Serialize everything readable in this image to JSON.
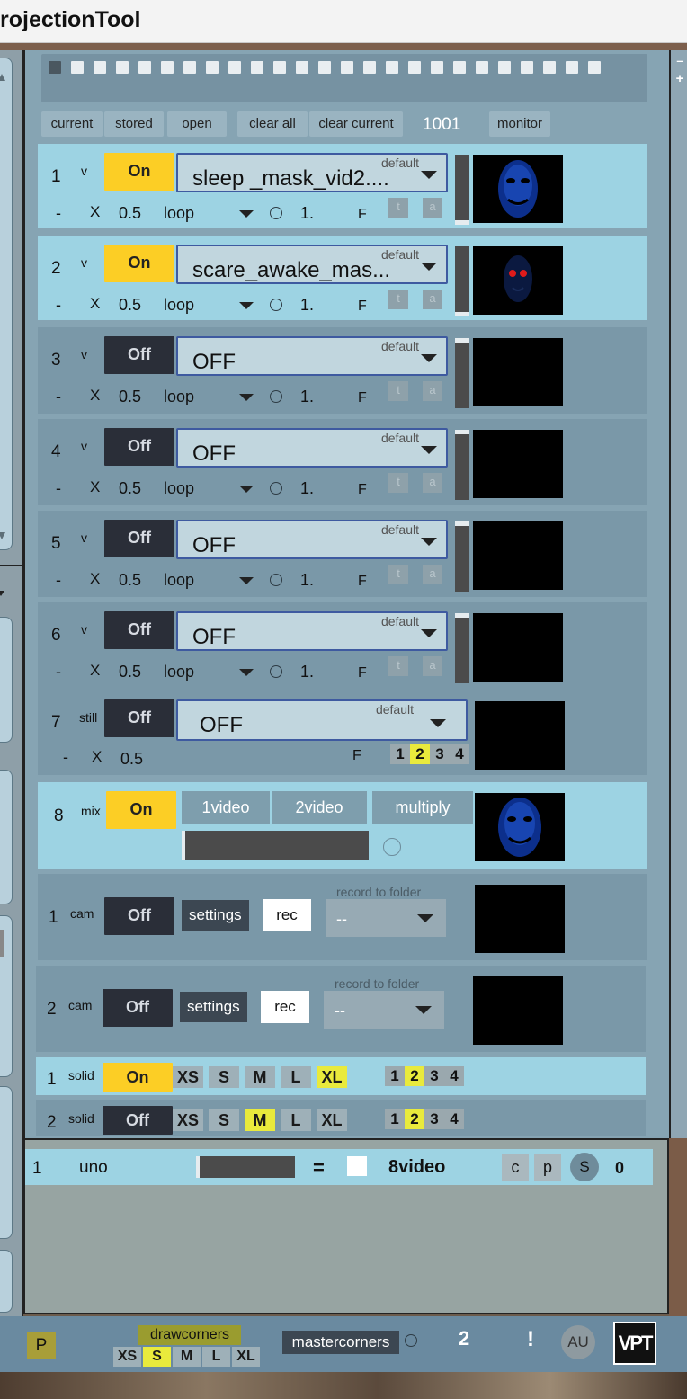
{
  "window": {
    "title": "rojectionTool"
  },
  "presets": {
    "count": 25,
    "selected_index": 0
  },
  "toolbar": {
    "current": "current",
    "stored": "stored",
    "open": "open",
    "clear_all": "clear all",
    "clear_current": "clear current",
    "counter": "1001",
    "monitor": "monitor"
  },
  "video_rows": [
    {
      "num": "1",
      "type": "v",
      "state": "On",
      "default_label": "default",
      "file": "sleep _mask_vid2....",
      "minus": "-",
      "x": "X",
      "speed": "0.5",
      "loop": "loop",
      "rate": "1.",
      "f": "F",
      "t": "t",
      "a": "a",
      "thumb": "face-blue"
    },
    {
      "num": "2",
      "type": "v",
      "state": "On",
      "default_label": "default",
      "file": "scare_awake_mas...",
      "minus": "-",
      "x": "X",
      "speed": "0.5",
      "loop": "loop",
      "rate": "1.",
      "f": "F",
      "t": "t",
      "a": "a",
      "thumb": "face-red-eyes"
    },
    {
      "num": "3",
      "type": "v",
      "state": "Off",
      "default_label": "default",
      "file": "OFF",
      "minus": "-",
      "x": "X",
      "speed": "0.5",
      "loop": "loop",
      "rate": "1.",
      "f": "F",
      "t": "t",
      "a": "a",
      "thumb": "black"
    },
    {
      "num": "4",
      "type": "v",
      "state": "Off",
      "default_label": "default",
      "file": "OFF",
      "minus": "-",
      "x": "X",
      "speed": "0.5",
      "loop": "loop",
      "rate": "1.",
      "f": "F",
      "t": "t",
      "a": "a",
      "thumb": "black"
    },
    {
      "num": "5",
      "type": "v",
      "state": "Off",
      "default_label": "default",
      "file": "OFF",
      "minus": "-",
      "x": "X",
      "speed": "0.5",
      "loop": "loop",
      "rate": "1.",
      "f": "F",
      "t": "t",
      "a": "a",
      "thumb": "black"
    },
    {
      "num": "6",
      "type": "v",
      "state": "Off",
      "default_label": "default",
      "file": "OFF",
      "minus": "-",
      "x": "X",
      "speed": "0.5",
      "loop": "loop",
      "rate": "1.",
      "f": "F",
      "t": "t",
      "a": "a",
      "thumb": "black"
    }
  ],
  "still_row": {
    "num": "7",
    "type": "still",
    "state": "Off",
    "default_label": "default",
    "file": "OFF",
    "minus": "-",
    "x": "X",
    "speed": "0.5",
    "f": "F",
    "nums": [
      "1",
      "2",
      "3",
      "4"
    ],
    "selected_num": "2"
  },
  "mix_row": {
    "num": "8",
    "type": "mix",
    "state": "On",
    "btn1": "1video",
    "btn2": "2video",
    "mode": "multiply",
    "thumb": "face-blue"
  },
  "cam_rows": [
    {
      "num": "1",
      "type": "cam",
      "state": "Off",
      "settings": "settings",
      "rec": "rec",
      "record_label": "record to folder",
      "folder": "--"
    },
    {
      "num": "2",
      "type": "cam",
      "state": "Off",
      "settings": "settings",
      "rec": "rec",
      "record_label": "record to folder",
      "folder": "--"
    }
  ],
  "solid_rows": [
    {
      "num": "1",
      "type": "solid",
      "state": "On",
      "sizes": [
        "XS",
        "S",
        "M",
        "L",
        "XL"
      ],
      "selected_size": "XL",
      "nums": [
        "1",
        "2",
        "3",
        "4"
      ],
      "selected_num": "2"
    },
    {
      "num": "2",
      "type": "solid",
      "state": "Off",
      "sizes": [
        "XS",
        "S",
        "M",
        "L",
        "XL"
      ],
      "selected_size": "M",
      "nums": [
        "1",
        "2",
        "3",
        "4"
      ],
      "selected_num": "2"
    }
  ],
  "output_row": {
    "num": "1",
    "name": "uno",
    "equals": "=",
    "source": "8video",
    "c": "c",
    "p": "p",
    "s": "S",
    "value": "0"
  },
  "footer": {
    "p": "P",
    "drawcorners": "drawcorners",
    "sizes": [
      "XS",
      "S",
      "M",
      "L",
      "XL"
    ],
    "selected_size": "S",
    "mastercorners": "mastercorners",
    "count": "2",
    "alert": "!",
    "au": "AU",
    "logo": "VPT"
  },
  "colors": {
    "on": "#fcce25",
    "off": "#2a2e38",
    "highlight": "#e9ea3c",
    "row_light": "#9dd3e3",
    "row_dark": "#7a98a8",
    "select_border": "#3e5aa0"
  }
}
